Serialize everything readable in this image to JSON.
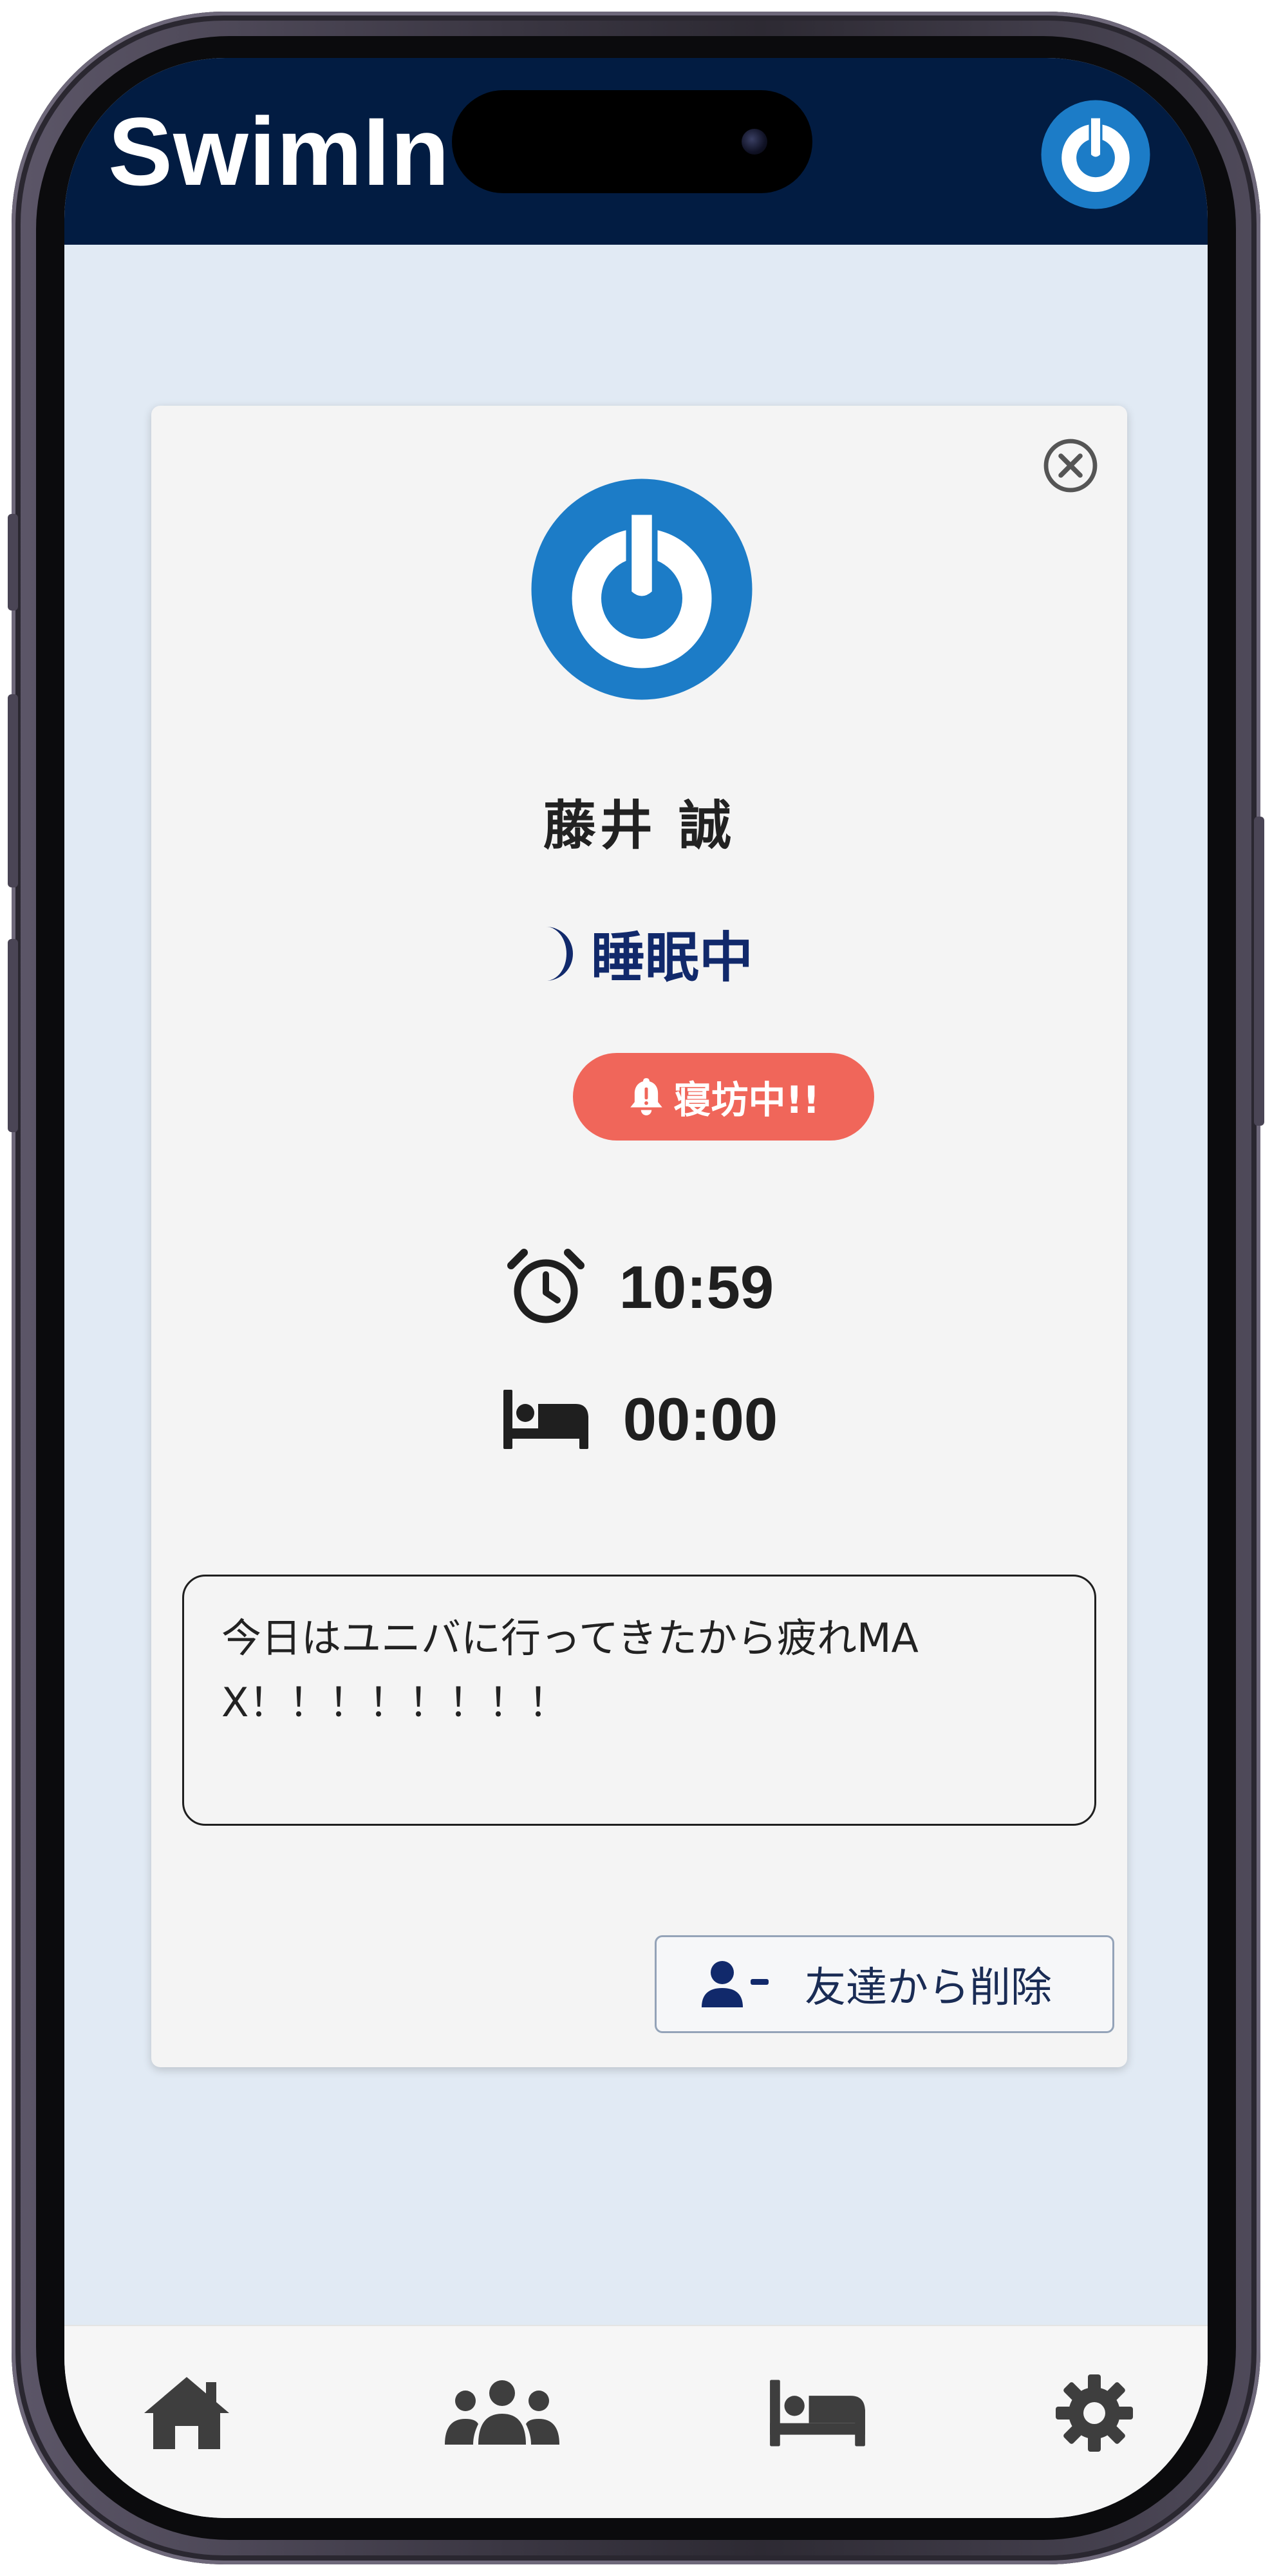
{
  "app": {
    "title": "SwimIn"
  },
  "profile": {
    "name": "藤井 誠",
    "status": "睡眠中",
    "badge": "寝坊中!!",
    "alarm_time": "10:59",
    "sleep_time": "00:00",
    "message": "今日はユニバに行ってきたから疲れMAX！！！！！！！！"
  },
  "actions": {
    "remove_friend_label": "友達から削除"
  },
  "nav": {
    "items": [
      {
        "icon": "home-icon"
      },
      {
        "icon": "friends-icon"
      },
      {
        "icon": "bed-icon"
      },
      {
        "icon": "gear-icon"
      }
    ]
  },
  "colors": {
    "header_bg": "#021c42",
    "screen_bg": "#e1eaf4",
    "avatar_blue": "#1c7cc7",
    "status_navy": "#11296b",
    "badge_red": "#f0665a"
  }
}
